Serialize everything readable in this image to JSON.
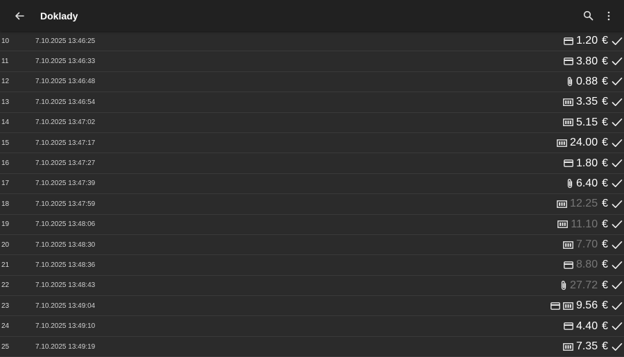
{
  "appbar": {
    "title": "Doklady",
    "back_icon": "arrow-left-icon",
    "search_icon": "search-icon",
    "more_icon": "more-vertical-icon"
  },
  "currency": "€",
  "colors": {
    "amount_active": "#ffffff",
    "amount_dim": "#777777",
    "background": "#2b2b2b",
    "appbar": "#212121"
  },
  "rows": [
    {
      "num": "10",
      "date": "7.10.2025 13:46:25",
      "icons": [
        "card"
      ],
      "amount": "1.20",
      "dim": false
    },
    {
      "num": "11",
      "date": "7.10.2025 13:46:33",
      "icons": [
        "card"
      ],
      "amount": "3.80",
      "dim": false
    },
    {
      "num": "12",
      "date": "7.10.2025 13:46:48",
      "icons": [
        "clip"
      ],
      "amount": "0.88",
      "dim": false
    },
    {
      "num": "13",
      "date": "7.10.2025 13:46:54",
      "icons": [
        "cash"
      ],
      "amount": "3.35",
      "dim": false
    },
    {
      "num": "14",
      "date": "7.10.2025 13:47:02",
      "icons": [
        "cash"
      ],
      "amount": "5.15",
      "dim": false
    },
    {
      "num": "15",
      "date": "7.10.2025 13:47:17",
      "icons": [
        "cash"
      ],
      "amount": "24.00",
      "dim": false
    },
    {
      "num": "16",
      "date": "7.10.2025 13:47:27",
      "icons": [
        "card"
      ],
      "amount": "1.80",
      "dim": false
    },
    {
      "num": "17",
      "date": "7.10.2025 13:47:39",
      "icons": [
        "clip"
      ],
      "amount": "6.40",
      "dim": false
    },
    {
      "num": "18",
      "date": "7.10.2025 13:47:59",
      "icons": [
        "cash"
      ],
      "amount": "12.25",
      "dim": true
    },
    {
      "num": "19",
      "date": "7.10.2025 13:48:06",
      "icons": [
        "cash"
      ],
      "amount": "11.10",
      "dim": true
    },
    {
      "num": "20",
      "date": "7.10.2025 13:48:30",
      "icons": [
        "cash"
      ],
      "amount": "7.70",
      "dim": true
    },
    {
      "num": "21",
      "date": "7.10.2025 13:48:36",
      "icons": [
        "card"
      ],
      "amount": "8.80",
      "dim": true
    },
    {
      "num": "22",
      "date": "7.10.2025 13:48:43",
      "icons": [
        "clip"
      ],
      "amount": "27.72",
      "dim": true
    },
    {
      "num": "23",
      "date": "7.10.2025 13:49:04",
      "icons": [
        "card",
        "cash"
      ],
      "amount": "9.56",
      "dim": false
    },
    {
      "num": "24",
      "date": "7.10.2025 13:49:10",
      "icons": [
        "card"
      ],
      "amount": "4.40",
      "dim": false
    },
    {
      "num": "25",
      "date": "7.10.2025 13:49:19",
      "icons": [
        "cash"
      ],
      "amount": "7.35",
      "dim": false
    }
  ]
}
